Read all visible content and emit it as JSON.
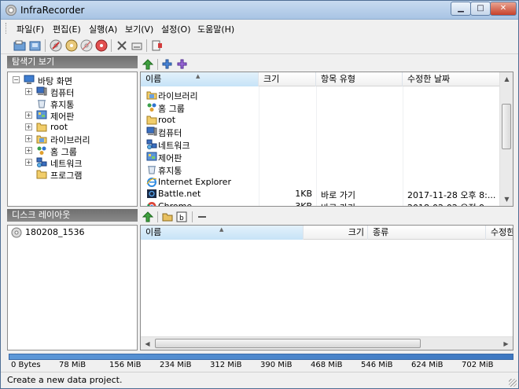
{
  "window": {
    "title": "InfraRecorder"
  },
  "menu": [
    "파일(F)",
    "편집(E)",
    "실행(A)",
    "보기(V)",
    "설정(O)",
    "도움말(H)"
  ],
  "explorer": {
    "header": "탐색기 보기",
    "tree": [
      {
        "label": "바탕 화면",
        "icon": "desktop-icon",
        "exp": "−"
      },
      {
        "label": "컴퓨터",
        "icon": "computer-icon",
        "exp": "+"
      },
      {
        "label": "휴지통",
        "icon": "recycle-bin-icon",
        "exp": ""
      },
      {
        "label": "제어판",
        "icon": "control-panel-icon",
        "exp": "+"
      },
      {
        "label": "root",
        "icon": "folder-icon",
        "exp": "+"
      },
      {
        "label": "라이브러리",
        "icon": "library-icon",
        "exp": "+"
      },
      {
        "label": "홈 그룹",
        "icon": "homegroup-icon",
        "exp": "+"
      },
      {
        "label": "네트워크",
        "icon": "network-icon",
        "exp": "+"
      },
      {
        "label": "프로그램",
        "icon": "folder-icon",
        "exp": ""
      }
    ],
    "columns": [
      "이름",
      "크기",
      "항목 유형",
      "수정한 날짜"
    ],
    "files": [
      {
        "name": "라이브러리",
        "size": "",
        "type": "",
        "date": "",
        "icon": "library-icon"
      },
      {
        "name": "홈 그룹",
        "size": "",
        "type": "",
        "date": "",
        "icon": "homegroup-icon"
      },
      {
        "name": "root",
        "size": "",
        "type": "",
        "date": "",
        "icon": "folder-icon"
      },
      {
        "name": "컴퓨터",
        "size": "",
        "type": "",
        "date": "",
        "icon": "computer-icon"
      },
      {
        "name": "네트워크",
        "size": "",
        "type": "",
        "date": "",
        "icon": "network-icon"
      },
      {
        "name": "제어판",
        "size": "",
        "type": "",
        "date": "",
        "icon": "control-panel-icon"
      },
      {
        "name": "휴지통",
        "size": "",
        "type": "",
        "date": "",
        "icon": "recycle-bin-icon"
      },
      {
        "name": "Internet Explorer",
        "size": "",
        "type": "",
        "date": "",
        "icon": "ie-icon"
      },
      {
        "name": "Battle.net",
        "size": "1KB",
        "type": "바로 가기",
        "date": "2017-11-28 오후 8:...",
        "icon": "battlenet-icon"
      },
      {
        "name": "Chrome",
        "size": "3KB",
        "type": "바로 가기",
        "date": "2018-02-02 오전 9:...",
        "icon": "chrome-icon"
      }
    ]
  },
  "disc": {
    "header": "디스크 레이아웃",
    "project": "180208_1536",
    "columns": [
      "이름",
      "크기",
      "종류",
      "수정한"
    ]
  },
  "capacity": {
    "fill": 1.0,
    "marks": [
      "0 Bytes",
      "78 MiB",
      "156 MiB",
      "234 MiB",
      "312 MiB",
      "390 MiB",
      "468 MiB",
      "546 MiB",
      "624 MiB",
      "702 MiB"
    ]
  },
  "status": "Create a new data project."
}
